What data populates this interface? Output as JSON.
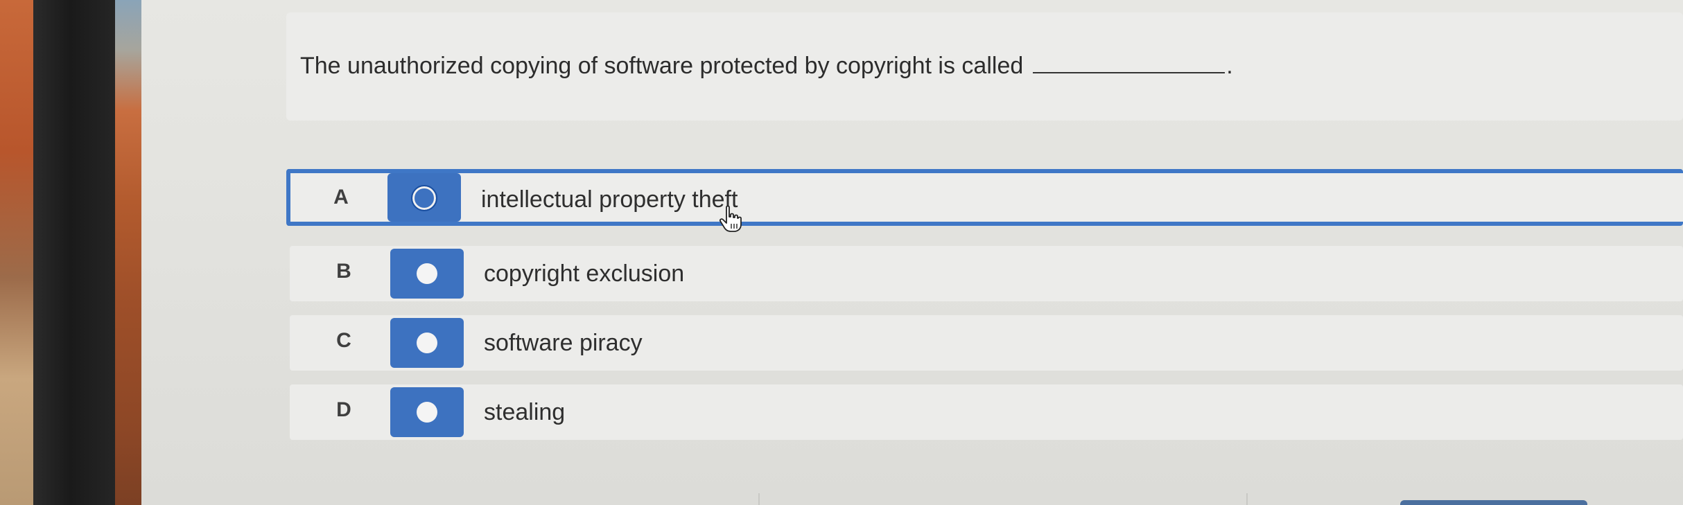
{
  "question": {
    "text": "The unauthorized copying of software protected by copyright is called",
    "end": "."
  },
  "options": [
    {
      "letter": "A",
      "label": "intellectual property theft",
      "selected": true
    },
    {
      "letter": "B",
      "label": "copyright exclusion",
      "selected": false
    },
    {
      "letter": "C",
      "label": "software piracy",
      "selected": false
    },
    {
      "letter": "D",
      "label": "stealing",
      "selected": false
    }
  ],
  "colors": {
    "accent": "#3d72c0",
    "selection_border": "#3f77c6",
    "card_bg": "#ececea"
  },
  "icons": {
    "cursor": "hand-pointer-icon"
  }
}
